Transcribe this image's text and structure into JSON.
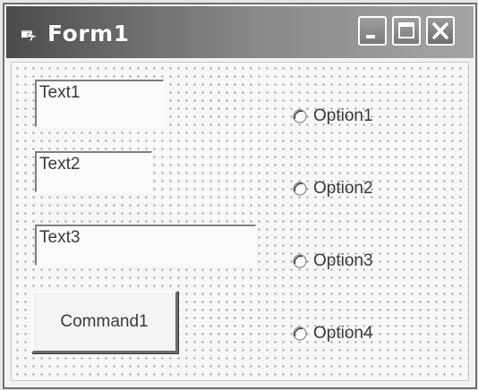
{
  "window": {
    "title": "Form1",
    "icon": "form-icon",
    "controls": [
      "minimize-icon",
      "maximize-icon",
      "close-icon"
    ]
  },
  "form": {
    "textboxes": [
      {
        "text": "Text1"
      },
      {
        "text": "Text2"
      },
      {
        "text": "Text3"
      }
    ],
    "command_button": {
      "label": "Command1"
    },
    "options": [
      {
        "label": "Option1",
        "selected": false
      },
      {
        "label": "Option2",
        "selected": false
      },
      {
        "label": "Option3",
        "selected": false
      },
      {
        "label": "Option4",
        "selected": false
      }
    ],
    "grid": true
  },
  "colors": {
    "title_gradient_start": "#4b4b4b",
    "title_gradient_end": "#a4a4a4",
    "title_text": "#ffffff",
    "client_background": "#f7f7f7"
  }
}
